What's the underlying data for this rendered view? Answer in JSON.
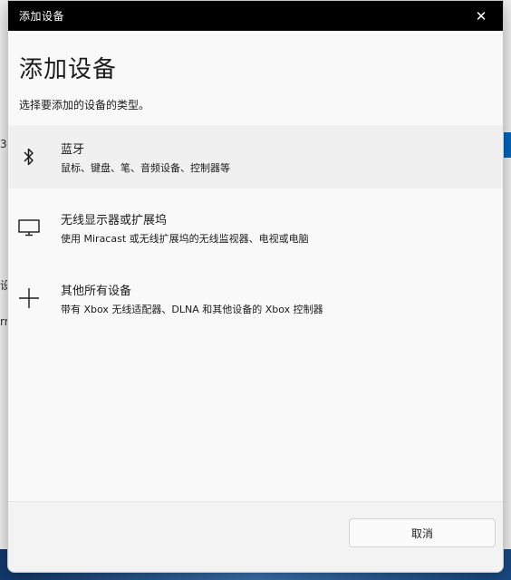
{
  "dialog": {
    "window_title": "添加设备",
    "heading": "添加设备",
    "subtitle": "选择要添加的设备的类型。",
    "close_glyph": "✕"
  },
  "options": [
    {
      "icon": "bluetooth-icon",
      "title": "蓝牙",
      "description": "鼠标、键盘、笔、音频设备、控制器等"
    },
    {
      "icon": "monitor-icon",
      "title": "无线显示器或扩展坞",
      "description": "使用 Miracast 或无线扩展坞的无线监视器、电视或电脑"
    },
    {
      "icon": "plus-icon",
      "title": "其他所有设备",
      "description": "带有 Xbox 无线适配器、DLNA 和其他设备的 Xbox 控制器"
    }
  ],
  "footer": {
    "cancel_label": "取消"
  },
  "background": {
    "frag_top": "3",
    "frag_mid": "设",
    "frag_low": "rr"
  },
  "colors": {
    "titlebar": "#000000",
    "accent": "#0067c0",
    "dialog_bg": "#f9f9f9"
  }
}
